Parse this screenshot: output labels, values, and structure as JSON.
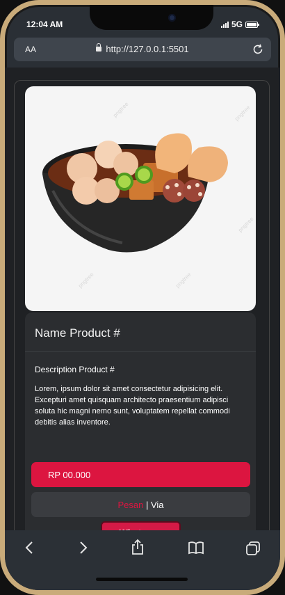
{
  "status_bar": {
    "time": "12:04 AM",
    "network": "5G"
  },
  "browser": {
    "aa_label": "AA",
    "url": "http://127.0.0.1:5501"
  },
  "product": {
    "name": "Name Product #",
    "description_title": "Description Product #",
    "description": "Lorem, ipsum dolor sit amet consectetur adipisicing elit. Excepturi amet quisquam architecto praesentium adipisci soluta hic magni nemo sunt, voluptatem repellat commodi debitis alias inventore.",
    "price": "RP 00.000",
    "image_watermark": "pngtree"
  },
  "order": {
    "pesan": "Pesan",
    "separator": " | ",
    "via": "Via",
    "whatsapp": "Whatsapp"
  },
  "colors": {
    "accent": "#dc1540",
    "background": "#1f2124",
    "card": "#2b2d30"
  },
  "toolbar_icons": [
    "back-icon",
    "forward-icon",
    "share-icon",
    "bookmarks-icon",
    "tabs-icon"
  ]
}
